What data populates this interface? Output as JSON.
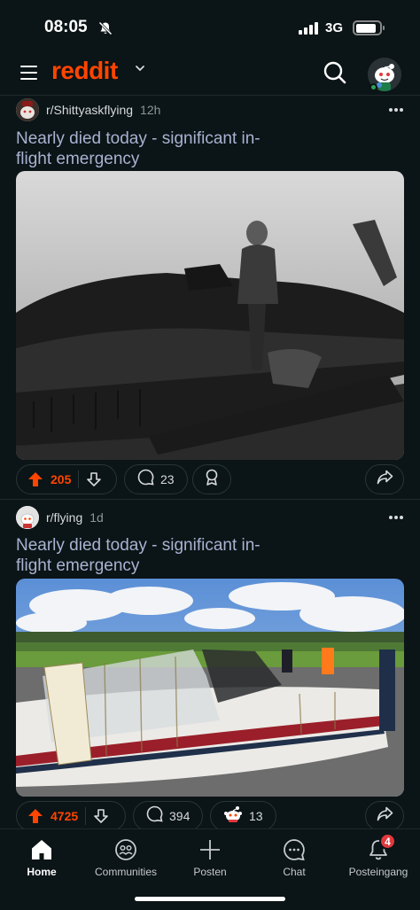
{
  "status_bar": {
    "time": "08:05",
    "network": "3G"
  },
  "header": {
    "logo": "reddit"
  },
  "posts": [
    {
      "subreddit": "r/Shittyaskflying",
      "age": "12h",
      "title": "Nearly died today - significant in-flight emergency",
      "upvotes": "205",
      "comments": "23"
    },
    {
      "subreddit": "r/flying",
      "age": "1d",
      "title": "Nearly died today - significant in-flight emergency",
      "upvotes": "4725",
      "comments": "394",
      "awards": "13"
    }
  ],
  "bottom_nav": {
    "items": [
      {
        "label": "Home",
        "icon": "home-icon"
      },
      {
        "label": "Communities",
        "icon": "communities-icon"
      },
      {
        "label": "Posten",
        "icon": "plus-icon"
      },
      {
        "label": "Chat",
        "icon": "chat-icon"
      },
      {
        "label": "Posteingang",
        "icon": "bell-icon"
      }
    ],
    "inbox_badge": "4"
  },
  "colors": {
    "accent": "#ff4500",
    "background": "#0b1416",
    "title": "#a9b2d1",
    "badge": "#e0383e"
  }
}
